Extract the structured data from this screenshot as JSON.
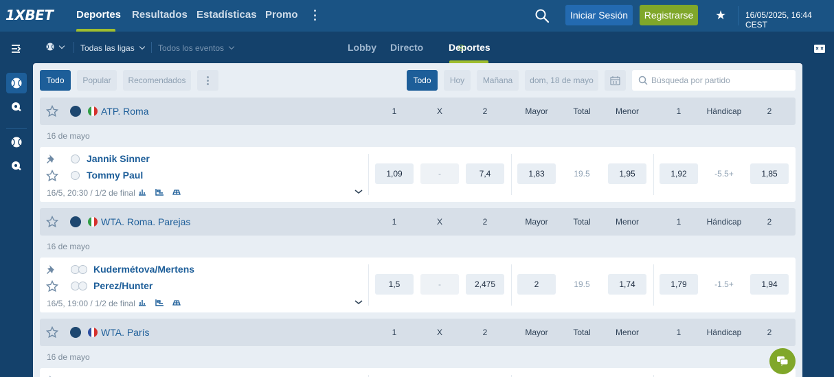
{
  "header": {
    "logo": "1XBET",
    "nav": [
      "Deportes",
      "Resultados",
      "Estadísticas",
      "Promo"
    ],
    "login": "Iniciar Sesión",
    "register": "Registrarse",
    "datetime": "16/05/2025, 16:44 CEST"
  },
  "subheader": {
    "leagues": "Todas las ligas",
    "events": "Todos los eventos",
    "modes": [
      "Lobby",
      "Directo",
      "Deportes"
    ]
  },
  "filters": {
    "category_chips": [
      "Todo",
      "Popular",
      "Recomendados"
    ],
    "date_chips": [
      "Todo",
      "Hoy",
      "Mañana",
      "dom, 18 de mayo"
    ],
    "search_placeholder": "Búsqueda por partido"
  },
  "columns": [
    "1",
    "X",
    "2",
    "Mayor",
    "Total",
    "Menor",
    "1",
    "Hándicap",
    "2"
  ],
  "leagues": [
    {
      "name": "ATP. Roma",
      "flag": "italy",
      "date": "16 de mayo",
      "match": {
        "player1": "Jannik Sinner",
        "player2": "Tommy Paul",
        "info": "16/5, 20:30 / 1/2 de final",
        "odds": {
          "w1": "1,09",
          "x": "-",
          "w2": "7,4",
          "over": "1,83",
          "total": "19.5",
          "under": "1,95",
          "h1": "1,92",
          "handicap": "-5.5+",
          "h2": "1,85"
        }
      }
    },
    {
      "name": "WTA. Roma. Parejas",
      "flag": "italy",
      "date": "16 de mayo",
      "match": {
        "player1": "Kudermétova/Mertens",
        "player2": "Perez/Hunter",
        "info": "16/5, 19:00 / 1/2 de final",
        "odds": {
          "w1": "1,5",
          "x": "-",
          "w2": "2,475",
          "over": "2",
          "total": "19.5",
          "under": "1,74",
          "h1": "1,79",
          "handicap": "-1.5+",
          "h2": "1,94"
        }
      }
    },
    {
      "name": "WTA. París",
      "flag": "france",
      "date": "16 de mayo"
    }
  ],
  "colors": {
    "header_bg": "#1a5384",
    "accent_green": "#80a72a",
    "primary_blue": "#1d5e99",
    "panel_bg": "#e8eef4"
  }
}
